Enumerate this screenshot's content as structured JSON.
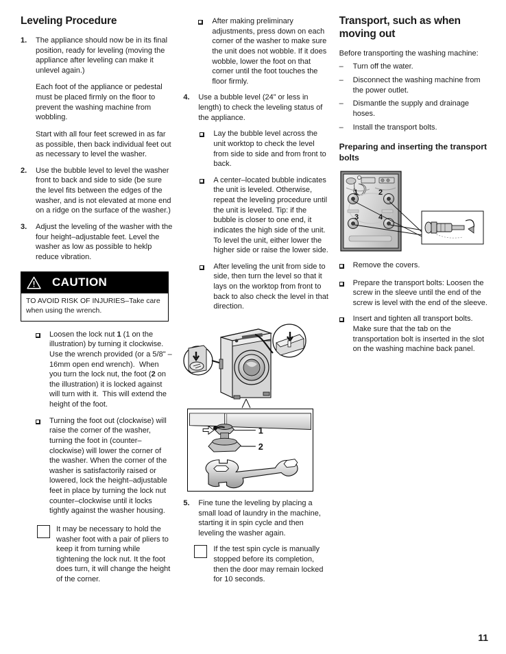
{
  "page": {
    "number": "11"
  },
  "col1": {
    "title": "Leveling Procedure",
    "steps": [
      {
        "num": "1.",
        "paras": [
          "The appliance should now be in its final position, ready for leveling (moving the appliance after leveling can make it unlevel again.)",
          "Each foot of the appliance or pedestal must be placed firmly on the floor to prevent the washing machine from wobbling.",
          "Start with all four feet screwed in as far as possible, then back individual feet out as necessary to level the washer."
        ]
      },
      {
        "num": "2.",
        "paras": [
          "Use the bubble level to level the washer front to back and side to side (be sure the level fits between the edges of the washer, and is not elevated at mone end on a ridge on the surface of the washer.)"
        ]
      },
      {
        "num": "3.",
        "paras": [
          "Adjust the leveling of the washer with the four height–adjustable feet.  Level the washer as low as possible to heklp reduce vibration."
        ]
      }
    ],
    "caution": {
      "heading": "CAUTION",
      "icon": "warning-triangle-icon",
      "text": "TO AVOID RISK OF INJURIES–Take care when using the wrench."
    },
    "bullets": [
      "Loosen the lock nut 1 (1 on the illustration) by turning it clockwise.  Use the wrench provided (or a 5/8\" – 16mm open end wrench).  When you turn the lock nut, the foot (2 on the illustration) it is locked against will turn with it.  This will extend the height of the foot.",
      "Turning the foot out (clockwise) will raise the corner of the washer, turning the foot in (counter–clockwise) will lower the corner of the washer.  When the corner of the washer is satisfactorily raised or lowered, lock the height–adjustable feet in place by turning the lock nut counter–clockwise until it locks tightly against the washer housing."
    ],
    "note": "It may be necessary to hold the washer foot with a pair of pliers to keep it from turning while tightening the lock nut.  It the foot does turn, it will change the height of the corner."
  },
  "col2": {
    "bullet_top": "After making preliminary adjustments, press down on each corner of the washer to make sure the unit does not wobble.  If it does wobble, lower the foot on that corner until the foot touches the floor firmly.",
    "step4": {
      "num": "4.",
      "text": "Use a bubble level (24” or less in length) to check the leveling status of the appliance.",
      "bullets": [
        "Lay the bubble level across the unit worktop to check the level from side to side and from front to back.",
        "A center–located bubble indicates the unit is leveled.  Otherwise, repeat the leveling procedure until the unit is leveled.  Tip: if the bubble is closer to one end, it indicates the high side of the unit.  To level the unit, either lower the higher side or raise the lower side.",
        "After leveling the unit from side to side, then turn the level so that it lays on the worktop from front to back to also check the level in that direction."
      ]
    },
    "figure_washer": {
      "name": "washer-leveling-illustration"
    },
    "figure_wrench": {
      "name": "wrench-and-foot-illustration",
      "labels": [
        "1",
        "2"
      ]
    },
    "step5": {
      "num": "5.",
      "text": "Fine tune the leveling by placing a small load of laundry in the machine, starting it in spin cycle and then leveling the washer again."
    },
    "note": "If the test spin cycle is manually stopped before its completion, then the door may remain locked for 10 seconds."
  },
  "col3": {
    "title": "Transport, such as when moving out",
    "lead": "Before transporting the washing machine:",
    "dashes": [
      "Turn off the water.",
      "Disconnect the washing machine from the power outlet.",
      "Dismantle the supply and drainage hoses.",
      "Install the transport bolts."
    ],
    "subtitle": "Preparing and inserting the transport bolts",
    "figure_bolts": {
      "name": "transport-bolts-back-panel-illustration",
      "labels": [
        "1",
        "2",
        "3",
        "4"
      ]
    },
    "bullets": [
      "Remove the covers.",
      "Prepare the transport bolts: Loosen the screw in the sleeve until the end of the screw is level with the end of the sleeve.",
      "Insert and tighten all transport bolts. Make sure that the tab on the transportation bolt is inserted in the slot on the washing machine back panel."
    ]
  }
}
